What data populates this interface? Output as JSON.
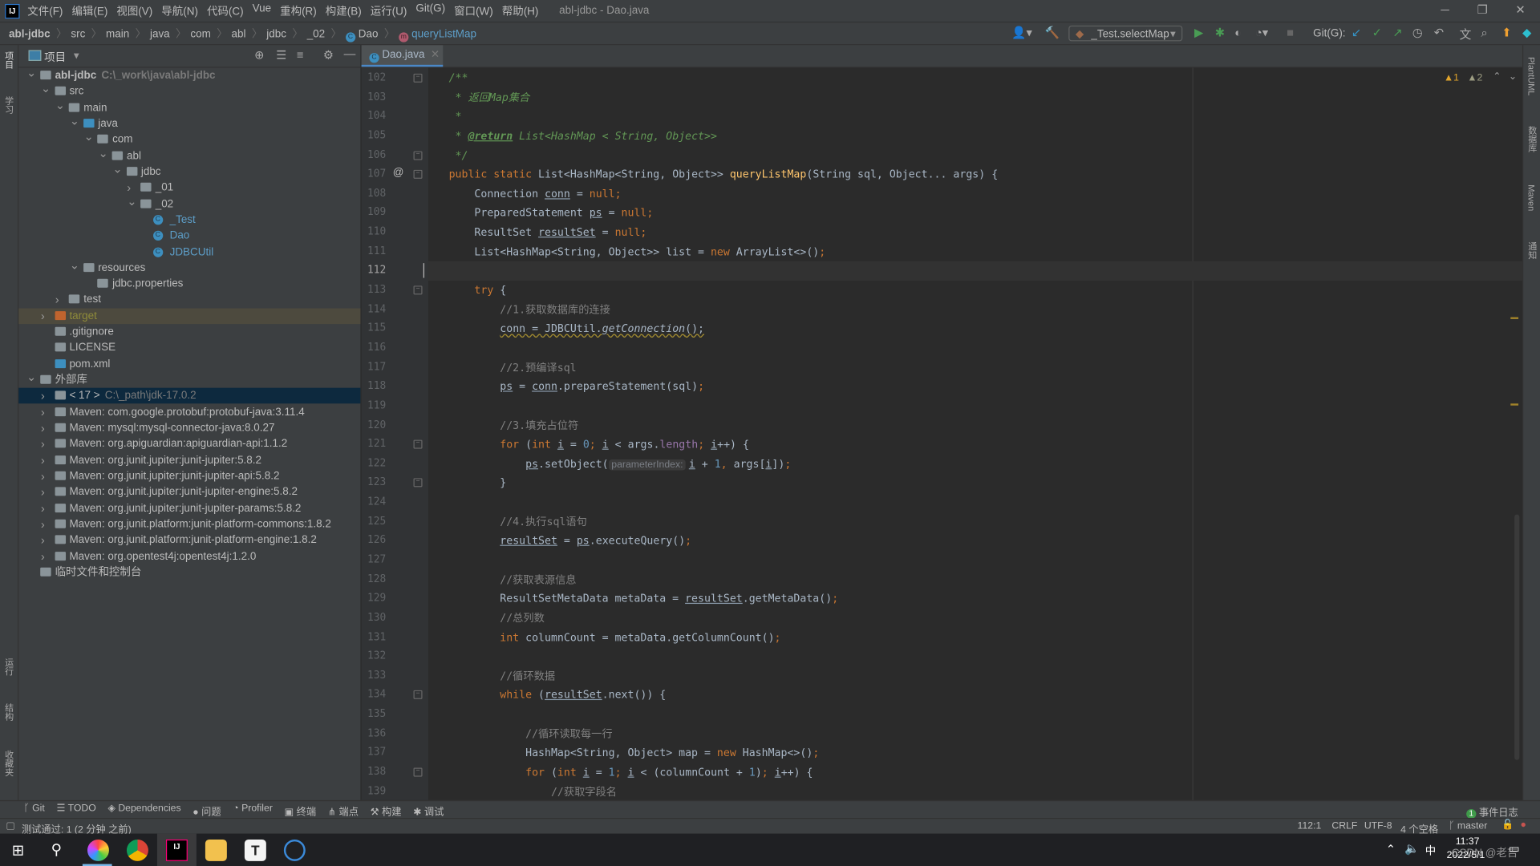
{
  "menu": {
    "items": [
      "文件(F)",
      "编辑(E)",
      "视图(V)",
      "导航(N)",
      "代码(C)",
      "Vue",
      "重构(R)",
      "构建(B)",
      "运行(U)",
      "Git(G)",
      "窗口(W)",
      "帮助(H)"
    ],
    "window_title": "abl-jdbc - Dao.java"
  },
  "breadcrumb": [
    "abl-jdbc",
    "src",
    "main",
    "java",
    "com",
    "abl",
    "jdbc",
    "_02",
    "Dao",
    "queryListMap"
  ],
  "toolbar": {
    "run_config": "_Test.selectMap",
    "git_label": "Git(G):"
  },
  "project": {
    "title": "项目",
    "tree": [
      {
        "label": "abl-jdbc",
        "hint": "C:\\_work\\java\\abl-jdbc",
        "level": 0,
        "arrow": "down",
        "icon": "module-folder",
        "bold": true
      },
      {
        "label": "src",
        "level": 1,
        "arrow": "down",
        "icon": "folder"
      },
      {
        "label": "main",
        "level": 2,
        "arrow": "down",
        "icon": "folder"
      },
      {
        "label": "java",
        "level": 3,
        "arrow": "down",
        "icon": "source-folder"
      },
      {
        "label": "com",
        "level": 4,
        "arrow": "down",
        "icon": "package"
      },
      {
        "label": "abl",
        "level": 5,
        "arrow": "down",
        "icon": "package"
      },
      {
        "label": "jdbc",
        "level": 6,
        "arrow": "down",
        "icon": "package"
      },
      {
        "label": "_01",
        "level": 7,
        "arrow": "right",
        "icon": "package"
      },
      {
        "label": "_02",
        "level": 7,
        "arrow": "down",
        "icon": "package"
      },
      {
        "label": "_Test",
        "level": 8,
        "arrow": "",
        "icon": "class",
        "color": "#5d9ec8"
      },
      {
        "label": "Dao",
        "level": 8,
        "arrow": "",
        "icon": "class",
        "color": "#5d9ec8"
      },
      {
        "label": "JDBCUtil",
        "level": 8,
        "arrow": "",
        "icon": "class",
        "color": "#5d9ec8"
      },
      {
        "label": "resources",
        "level": 3,
        "arrow": "down",
        "icon": "resources-folder"
      },
      {
        "label": "jdbc.properties",
        "level": 4,
        "arrow": "",
        "icon": "properties-file"
      },
      {
        "label": "test",
        "level": 2,
        "arrow": "right",
        "icon": "folder"
      },
      {
        "label": "target",
        "level": 1,
        "arrow": "right",
        "icon": "excluded-folder",
        "color": "#8f8b3a",
        "state": "target"
      },
      {
        "label": ".gitignore",
        "level": 1,
        "arrow": "",
        "icon": "ignore-file"
      },
      {
        "label": "LICENSE",
        "level": 1,
        "arrow": "",
        "icon": "text-file"
      },
      {
        "label": "pom.xml",
        "level": 1,
        "arrow": "",
        "icon": "maven-file"
      },
      {
        "label": "外部库",
        "level": 0,
        "arrow": "down",
        "icon": "library"
      },
      {
        "label": "< 17 >",
        "hint": "C:\\_path\\jdk-17.0.2",
        "level": 1,
        "arrow": "right",
        "icon": "jdk",
        "state": "selected"
      },
      {
        "label": "Maven: com.google.protobuf:protobuf-java:3.11.4",
        "level": 1,
        "arrow": "right",
        "icon": "library"
      },
      {
        "label": "Maven: mysql:mysql-connector-java:8.0.27",
        "level": 1,
        "arrow": "right",
        "icon": "library"
      },
      {
        "label": "Maven: org.apiguardian:apiguardian-api:1.1.2",
        "level": 1,
        "arrow": "right",
        "icon": "library"
      },
      {
        "label": "Maven: org.junit.jupiter:junit-jupiter:5.8.2",
        "level": 1,
        "arrow": "right",
        "icon": "library"
      },
      {
        "label": "Maven: org.junit.jupiter:junit-jupiter-api:5.8.2",
        "level": 1,
        "arrow": "right",
        "icon": "library"
      },
      {
        "label": "Maven: org.junit.jupiter:junit-jupiter-engine:5.8.2",
        "level": 1,
        "arrow": "right",
        "icon": "library"
      },
      {
        "label": "Maven: org.junit.jupiter:junit-jupiter-params:5.8.2",
        "level": 1,
        "arrow": "right",
        "icon": "library"
      },
      {
        "label": "Maven: org.junit.platform:junit-platform-commons:1.8.2",
        "level": 1,
        "arrow": "right",
        "icon": "library"
      },
      {
        "label": "Maven: org.junit.platform:junit-platform-engine:1.8.2",
        "level": 1,
        "arrow": "right",
        "icon": "library"
      },
      {
        "label": "Maven: org.opentest4j:opentest4j:1.2.0",
        "level": 1,
        "arrow": "right",
        "icon": "library"
      },
      {
        "label": "临时文件和控制台",
        "level": 0,
        "arrow": "",
        "icon": "scratches"
      }
    ]
  },
  "editor": {
    "tab": "Dao.java",
    "warnings": "1",
    "weak_warnings": "2",
    "current_line": 112,
    "lines": [
      {
        "n": 102,
        "fold": true,
        "t": [
          [
            "d",
            "/**"
          ]
        ]
      },
      {
        "n": 103,
        "t": [
          [
            "d",
            " * 返回Map集合"
          ]
        ]
      },
      {
        "n": 104,
        "t": [
          [
            "d",
            " *"
          ]
        ]
      },
      {
        "n": 105,
        "t": [
          [
            "d",
            " * "
          ],
          [
            "dt",
            "@return"
          ],
          [
            "d",
            " List<HashMap < String, Object>>"
          ]
        ]
      },
      {
        "n": 106,
        "fold": true,
        "t": [
          [
            "d",
            " */"
          ]
        ]
      },
      {
        "n": 107,
        "fold": true,
        "at": true,
        "t": [
          [
            "k",
            "public static "
          ],
          [
            "",
            "List<HashMap<String, Object>> "
          ],
          [
            "f",
            "queryListMap"
          ],
          [
            "",
            "(String sql, Object... args) {"
          ]
        ]
      },
      {
        "n": 108,
        "t": [
          [
            "",
            "    Connection "
          ],
          [
            "u",
            "conn"
          ],
          [
            "",
            " = "
          ],
          [
            "k",
            "null;"
          ]
        ]
      },
      {
        "n": 109,
        "t": [
          [
            "",
            "    PreparedStatement "
          ],
          [
            "u",
            "ps"
          ],
          [
            "",
            " = "
          ],
          [
            "k",
            "null;"
          ]
        ]
      },
      {
        "n": 110,
        "t": [
          [
            "",
            "    ResultSet "
          ],
          [
            "u",
            "resultSet"
          ],
          [
            "",
            " = "
          ],
          [
            "k",
            "null;"
          ]
        ]
      },
      {
        "n": 111,
        "t": [
          [
            "",
            "    List<HashMap<String, Object>> list = "
          ],
          [
            "k",
            "new "
          ],
          [
            "",
            "ArrayList<>()"
          ],
          [
            "k",
            ";"
          ]
        ]
      },
      {
        "n": 112,
        "t": []
      },
      {
        "n": 113,
        "fold": true,
        "t": [
          [
            "k",
            "    try "
          ],
          [
            "",
            "{"
          ]
        ]
      },
      {
        "n": 114,
        "t": [
          [
            "c",
            "        //1.获取数据库的连接"
          ]
        ]
      },
      {
        "n": 115,
        "t": [
          [
            "",
            "        "
          ],
          [
            "w",
            "conn = JDBCUtil."
          ],
          [
            "w it",
            "getConnection"
          ],
          [
            "w",
            "();"
          ]
        ]
      },
      {
        "n": 116,
        "t": []
      },
      {
        "n": 117,
        "t": [
          [
            "c",
            "        //2.预编译sql"
          ]
        ]
      },
      {
        "n": 118,
        "t": [
          [
            "",
            "        "
          ],
          [
            "u",
            "ps"
          ],
          [
            "",
            " = "
          ],
          [
            "u",
            "conn"
          ],
          [
            "",
            ".prepareStatement(sql)"
          ],
          [
            "k",
            ";"
          ]
        ]
      },
      {
        "n": 119,
        "t": []
      },
      {
        "n": 120,
        "t": [
          [
            "c",
            "        //3.填充占位符"
          ]
        ]
      },
      {
        "n": 121,
        "fold": true,
        "t": [
          [
            "k",
            "        for "
          ],
          [
            "",
            "("
          ],
          [
            "k",
            "int "
          ],
          [
            "u",
            "i"
          ],
          [
            "",
            " = "
          ],
          [
            "n",
            "0"
          ],
          [
            "k",
            "; "
          ],
          [
            "u",
            "i"
          ],
          [
            "",
            " < args."
          ],
          [
            "fl",
            "length"
          ],
          [
            "k",
            "; "
          ],
          [
            "u",
            "i"
          ],
          [
            "",
            "++) {"
          ]
        ]
      },
      {
        "n": 122,
        "t": [
          [
            "",
            "            "
          ],
          [
            "u",
            "ps"
          ],
          [
            "",
            ".setObject("
          ],
          [
            "h",
            "parameterIndex:"
          ],
          [
            "u",
            "i"
          ],
          [
            "",
            " + "
          ],
          [
            "n",
            "1"
          ],
          [
            "k",
            ", "
          ],
          [
            "",
            "args["
          ],
          [
            "u",
            "i"
          ],
          [
            "",
            "])"
          ],
          [
            "k",
            ";"
          ]
        ]
      },
      {
        "n": 123,
        "fold": true,
        "t": [
          [
            "",
            "        }"
          ]
        ]
      },
      {
        "n": 124,
        "t": []
      },
      {
        "n": 125,
        "t": [
          [
            "c",
            "        //4.执行sql语句"
          ]
        ]
      },
      {
        "n": 126,
        "t": [
          [
            "",
            "        "
          ],
          [
            "u",
            "resultSet"
          ],
          [
            "",
            " = "
          ],
          [
            "u",
            "ps"
          ],
          [
            "",
            ".executeQuery()"
          ],
          [
            "k",
            ";"
          ]
        ]
      },
      {
        "n": 127,
        "t": []
      },
      {
        "n": 128,
        "t": [
          [
            "c",
            "        //获取表源信息"
          ]
        ]
      },
      {
        "n": 129,
        "t": [
          [
            "",
            "        ResultSetMetaData metaData = "
          ],
          [
            "u",
            "resultSet"
          ],
          [
            "",
            ".getMetaData()"
          ],
          [
            "k",
            ";"
          ]
        ]
      },
      {
        "n": 130,
        "t": [
          [
            "c",
            "        //总列数"
          ]
        ]
      },
      {
        "n": 131,
        "t": [
          [
            "k",
            "        int "
          ],
          [
            "",
            "columnCount = metaData.getColumnCount()"
          ],
          [
            "k",
            ";"
          ]
        ]
      },
      {
        "n": 132,
        "t": []
      },
      {
        "n": 133,
        "t": [
          [
            "c",
            "        //循环数据"
          ]
        ]
      },
      {
        "n": 134,
        "fold": true,
        "t": [
          [
            "k",
            "        while "
          ],
          [
            "",
            "("
          ],
          [
            "u",
            "resultSet"
          ],
          [
            "",
            ".next()) {"
          ]
        ]
      },
      {
        "n": 135,
        "t": []
      },
      {
        "n": 136,
        "t": [
          [
            "c",
            "            //循环读取每一行"
          ]
        ]
      },
      {
        "n": 137,
        "t": [
          [
            "",
            "            HashMap<String, Object> map = "
          ],
          [
            "k",
            "new "
          ],
          [
            "",
            "HashMap<>()"
          ],
          [
            "k",
            ";"
          ]
        ]
      },
      {
        "n": 138,
        "fold": true,
        "t": [
          [
            "k",
            "            for "
          ],
          [
            "",
            "("
          ],
          [
            "k",
            "int "
          ],
          [
            "u",
            "i"
          ],
          [
            "",
            " = "
          ],
          [
            "n",
            "1"
          ],
          [
            "k",
            "; "
          ],
          [
            "u",
            "i"
          ],
          [
            "",
            " < (columnCount + "
          ],
          [
            "n",
            "1"
          ],
          [
            "",
            ")"
          ],
          [
            "k",
            "; "
          ],
          [
            "u",
            "i"
          ],
          [
            "",
            "++) {"
          ]
        ]
      },
      {
        "n": 139,
        "t": [
          [
            "c",
            "                //获取字段名"
          ]
        ]
      }
    ]
  },
  "tool_windows": [
    "Git",
    "TODO",
    "Dependencies",
    "问题",
    "Profiler",
    "终端",
    "端点",
    "构建",
    "调试"
  ],
  "event_log": {
    "count": "1",
    "label": "事件日志"
  },
  "status": {
    "message": "测试通过: 1 (2 分钟 之前)",
    "position": "112:1",
    "line_sep": "CRLF",
    "encoding": "UTF-8",
    "indent": "4 个空格",
    "branch": "master"
  },
  "taskbar": {
    "time": "11:37",
    "date": "2022/5/1",
    "ime": "中",
    "watermark": "CSDN @老吉"
  },
  "side_labels": {
    "project": "项目",
    "learn": "学习",
    "run": "运行",
    "structure": "结构",
    "favorites": "收藏夹",
    "plantuml": "PlantUML",
    "database": "数据库",
    "maven": "Maven",
    "notify": "通知"
  }
}
